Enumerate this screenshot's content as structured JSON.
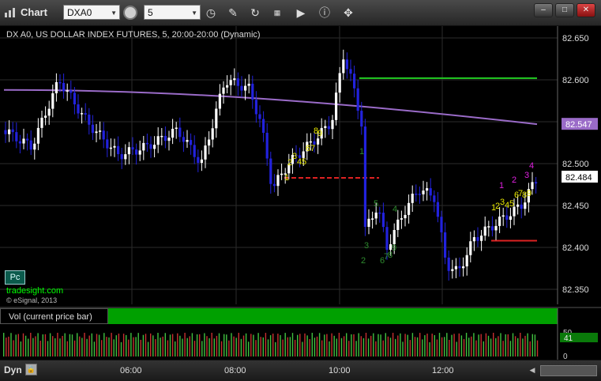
{
  "window": {
    "title": "Chart"
  },
  "toolbar": {
    "symbol": "DXA0",
    "interval": "5"
  },
  "chart": {
    "header": "DX A0, US DOLLAR INDEX FUTURES, 5, 20:00-20:00 (Dynamic)",
    "watermark_site": "tradesight.com",
    "watermark_copy": "© eSignal, 2013",
    "pc_button": "Pc",
    "price_ticks": [
      "82.650",
      "82.600",
      "82.550",
      "82.500",
      "82.450",
      "82.400",
      "82.350"
    ],
    "price_badges": [
      "82.547",
      "82.484"
    ],
    "colors": {
      "background": "#000000",
      "grid": "#2b2b2b",
      "up_candle": "#ffffff",
      "down_candle": "#2222dd",
      "moving_average": "#9a6bc8",
      "resistance_line": "#22cc22",
      "support_line": "#dd2222",
      "count_yellow": "#e6e600",
      "count_magenta": "#e020e0",
      "count_green": "#2e8b2e"
    }
  },
  "volume": {
    "label": "Vol (current price bar)",
    "ticks": [
      "50",
      "0"
    ],
    "value": "41"
  },
  "bottom": {
    "dyn": "Dyn",
    "times": [
      "06:00",
      "08:00",
      "10:00",
      "12:00"
    ]
  },
  "chart_data": {
    "type": "candlestick",
    "title": "DX A0, US DOLLAR INDEX FUTURES, 5, 20:00-20:00 (Dynamic)",
    "ylim": [
      82.33,
      82.67
    ],
    "x_ticks": [
      "06:00",
      "08:00",
      "10:00",
      "12:00"
    ],
    "moving_average": {
      "start": 82.588,
      "mid": 82.577,
      "end": 82.547
    },
    "levels": {
      "resistance": 82.602,
      "support1": 82.483,
      "support2": 82.408
    },
    "last_price": 82.484
  }
}
